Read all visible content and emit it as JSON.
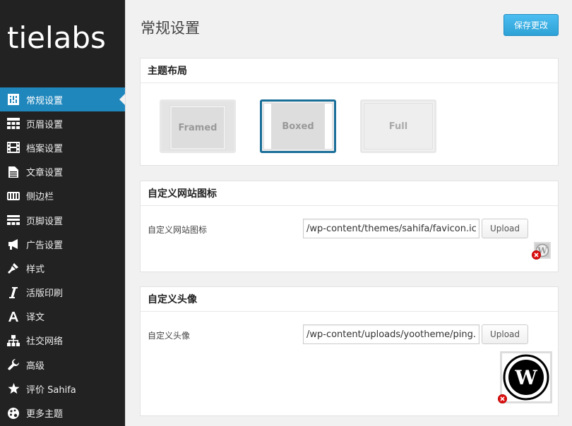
{
  "brand": {
    "logo_text": "tielabs"
  },
  "sidebar": {
    "items": [
      {
        "label": "常规设置",
        "icon": "general-settings-icon",
        "active": true
      },
      {
        "label": "页眉设置",
        "icon": "header-grid-icon"
      },
      {
        "label": "档案设置",
        "icon": "archive-film-icon"
      },
      {
        "label": "文章设置",
        "icon": "article-doc-icon"
      },
      {
        "label": "侧边栏",
        "icon": "sidebar-icon"
      },
      {
        "label": "页脚设置",
        "icon": "footer-icon"
      },
      {
        "label": "广告设置",
        "icon": "megaphone-icon"
      },
      {
        "label": "样式",
        "icon": "brush-icon"
      },
      {
        "label": "活版印刷",
        "icon": "italic-icon"
      },
      {
        "label": "译文",
        "icon": "translate-a-icon"
      },
      {
        "label": "社交网络",
        "icon": "sitemap-icon"
      },
      {
        "label": "高级",
        "icon": "wrench-icon"
      },
      {
        "label": "评价 Sahifa",
        "icon": "star-icon"
      },
      {
        "label": "更多主题",
        "icon": "palette-icon"
      }
    ]
  },
  "header": {
    "title": "常规设置",
    "save_label": "保存更改"
  },
  "layout_panel": {
    "title": "主题布局",
    "options": [
      {
        "label": "Framed",
        "selected": false
      },
      {
        "label": "Boxed",
        "selected": true
      },
      {
        "label": "Full",
        "selected": false
      }
    ]
  },
  "favicon_panel": {
    "title": "自定义网站图标",
    "field_label": "自定义网站图标",
    "value": "/wp-content/themes/sahifa/favicon.ico",
    "upload_label": "Upload"
  },
  "avatar_panel": {
    "title": "自定义头像",
    "field_label": "自定义头像",
    "value": "/wp-content/uploads/yootheme/ping.png",
    "upload_label": "Upload"
  },
  "colors": {
    "accent": "#2087bd",
    "sidebar_bg": "#222222",
    "save_button": "#2ea2d6",
    "selected_border": "#1a6f99"
  }
}
